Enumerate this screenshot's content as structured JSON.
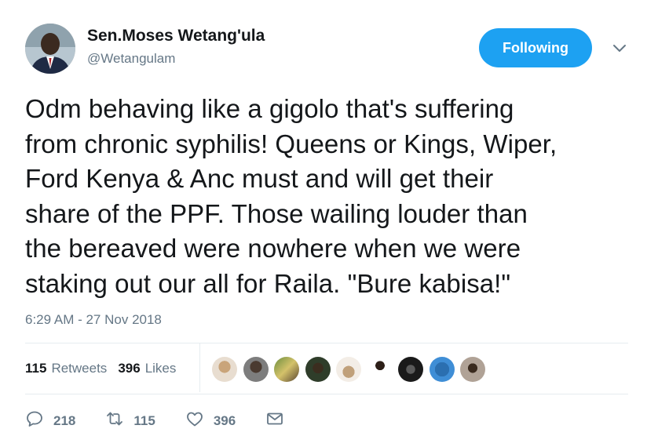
{
  "user": {
    "name": "Sen.Moses Wetang'ula",
    "handle": "@Wetangulam"
  },
  "follow_button": {
    "label": "Following",
    "color": "#1da1f2"
  },
  "tweet": {
    "lines": [
      "Odm behaving like a gigolo that's suffering",
      "from chronic syphilis! Queens or Kings, Wiper,",
      "Ford Kenya & Anc must and will get their",
      "share of the PPF. Those wailing louder than",
      "the bereaved were nowhere when we were",
      "staking out our all for Raila. \"Bure kabisa!\""
    ],
    "timestamp": "6:29 AM - 27 Nov 2018"
  },
  "stats": {
    "retweets_count": "115",
    "retweets_label": "Retweets",
    "likes_count": "396",
    "likes_label": "Likes"
  },
  "liker_avatars": [
    "avatar-1",
    "avatar-2",
    "avatar-3",
    "avatar-4",
    "avatar-5",
    "avatar-6",
    "avatar-7",
    "avatar-8",
    "avatar-9"
  ],
  "actions": {
    "reply_count": "218",
    "retweet_count": "115",
    "like_count": "396"
  },
  "icons": {
    "reply": "reply-icon",
    "retweet": "retweet-icon",
    "like": "heart-icon",
    "message": "envelope-icon",
    "caret": "chevron-down-icon"
  }
}
